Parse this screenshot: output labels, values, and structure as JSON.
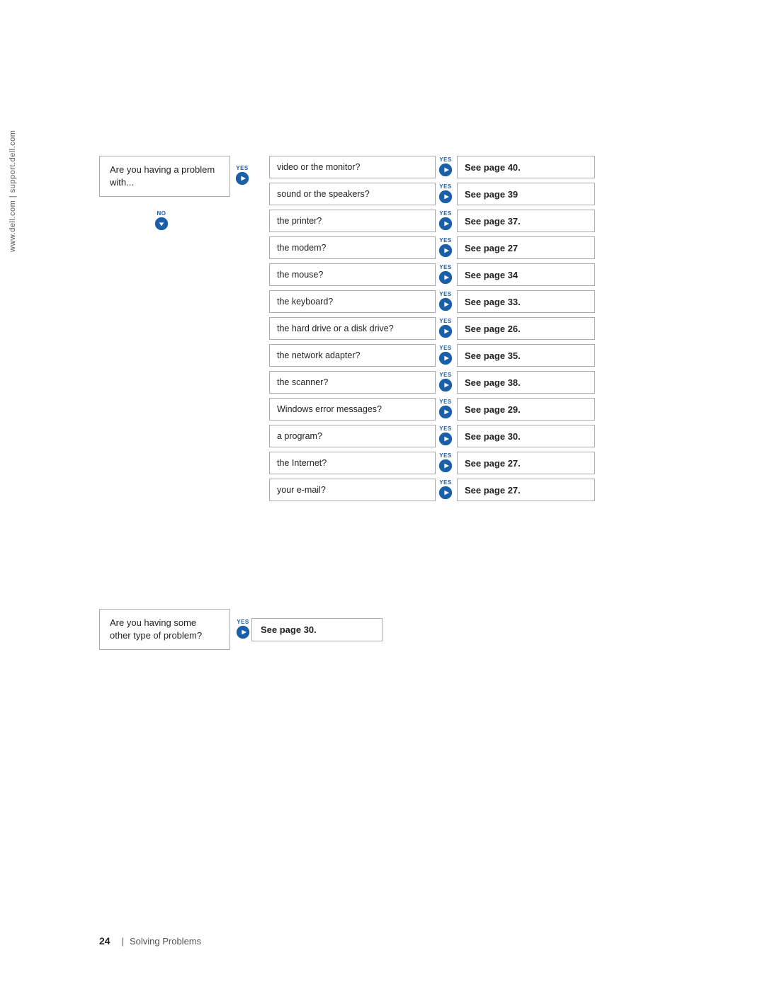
{
  "sideText": "www.dell.com | support.dell.com",
  "problemBox": {
    "text": "Are you having a problem with..."
  },
  "noLabel": "NO",
  "yesLabel": "YES",
  "questions": [
    {
      "id": 1,
      "question": "video or the monitor?",
      "answer": "See page 40."
    },
    {
      "id": 2,
      "question": "sound or the speakers?",
      "answer": "See page 39"
    },
    {
      "id": 3,
      "question": "the printer?",
      "answer": "See page 37."
    },
    {
      "id": 4,
      "question": "the modem?",
      "answer": "See page 27"
    },
    {
      "id": 5,
      "question": "the mouse?",
      "answer": "See page 34"
    },
    {
      "id": 6,
      "question": "the keyboard?",
      "answer": "See page 33."
    },
    {
      "id": 7,
      "question": "the hard drive or a disk drive?",
      "answer": "See page 26."
    },
    {
      "id": 8,
      "question": "the network adapter?",
      "answer": "See page 35."
    },
    {
      "id": 9,
      "question": "the scanner?",
      "answer": "See page 38."
    },
    {
      "id": 10,
      "question": "Windows error messages?",
      "answer": "See page 29."
    },
    {
      "id": 11,
      "question": "a program?",
      "answer": "See page 30."
    },
    {
      "id": 12,
      "question": "the Internet?",
      "answer": "See page 27."
    },
    {
      "id": 13,
      "question": "your e-mail?",
      "answer": "See page 27."
    }
  ],
  "otherProblem": {
    "question": "Are you having some other type of problem?",
    "answer": "See page 30."
  },
  "footer": {
    "pageNumber": "24",
    "separator": "|",
    "text": "Solving Problems"
  },
  "colors": {
    "blue": "#1a5fa8",
    "border": "#aaa",
    "text": "#222"
  }
}
